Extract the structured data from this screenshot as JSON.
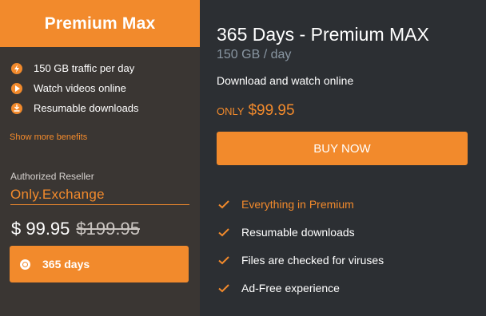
{
  "left": {
    "header_title": "Premium Max",
    "benefits": [
      {
        "icon": "lightning-icon",
        "label": "150 GB traffic per day"
      },
      {
        "icon": "play-icon",
        "label": "Watch videos online"
      },
      {
        "icon": "download-icon",
        "label": "Resumable downloads"
      }
    ],
    "show_more": "Show more benefits",
    "reseller_label": "Authorized Reseller",
    "reseller_name": "Only.Exchange",
    "price_current": "$ 99.95",
    "price_old": "$199.95",
    "duration_option": "365 days"
  },
  "right": {
    "plan_title": "365 Days - Premium MAX",
    "plan_sub": "150 GB / day",
    "plan_desc": "Download and watch online",
    "only_label": "ONLY",
    "only_price": "$99.95",
    "buy_label": "BUY NOW",
    "features": [
      "Everything in Premium",
      "Resumable downloads",
      "Files are checked for viruses",
      "Ad-Free experience"
    ]
  },
  "colors": {
    "accent": "#f28a2c",
    "left_bg": "#3a3633",
    "right_bg": "#2c2f33",
    "subtext": "#8a97a3"
  }
}
